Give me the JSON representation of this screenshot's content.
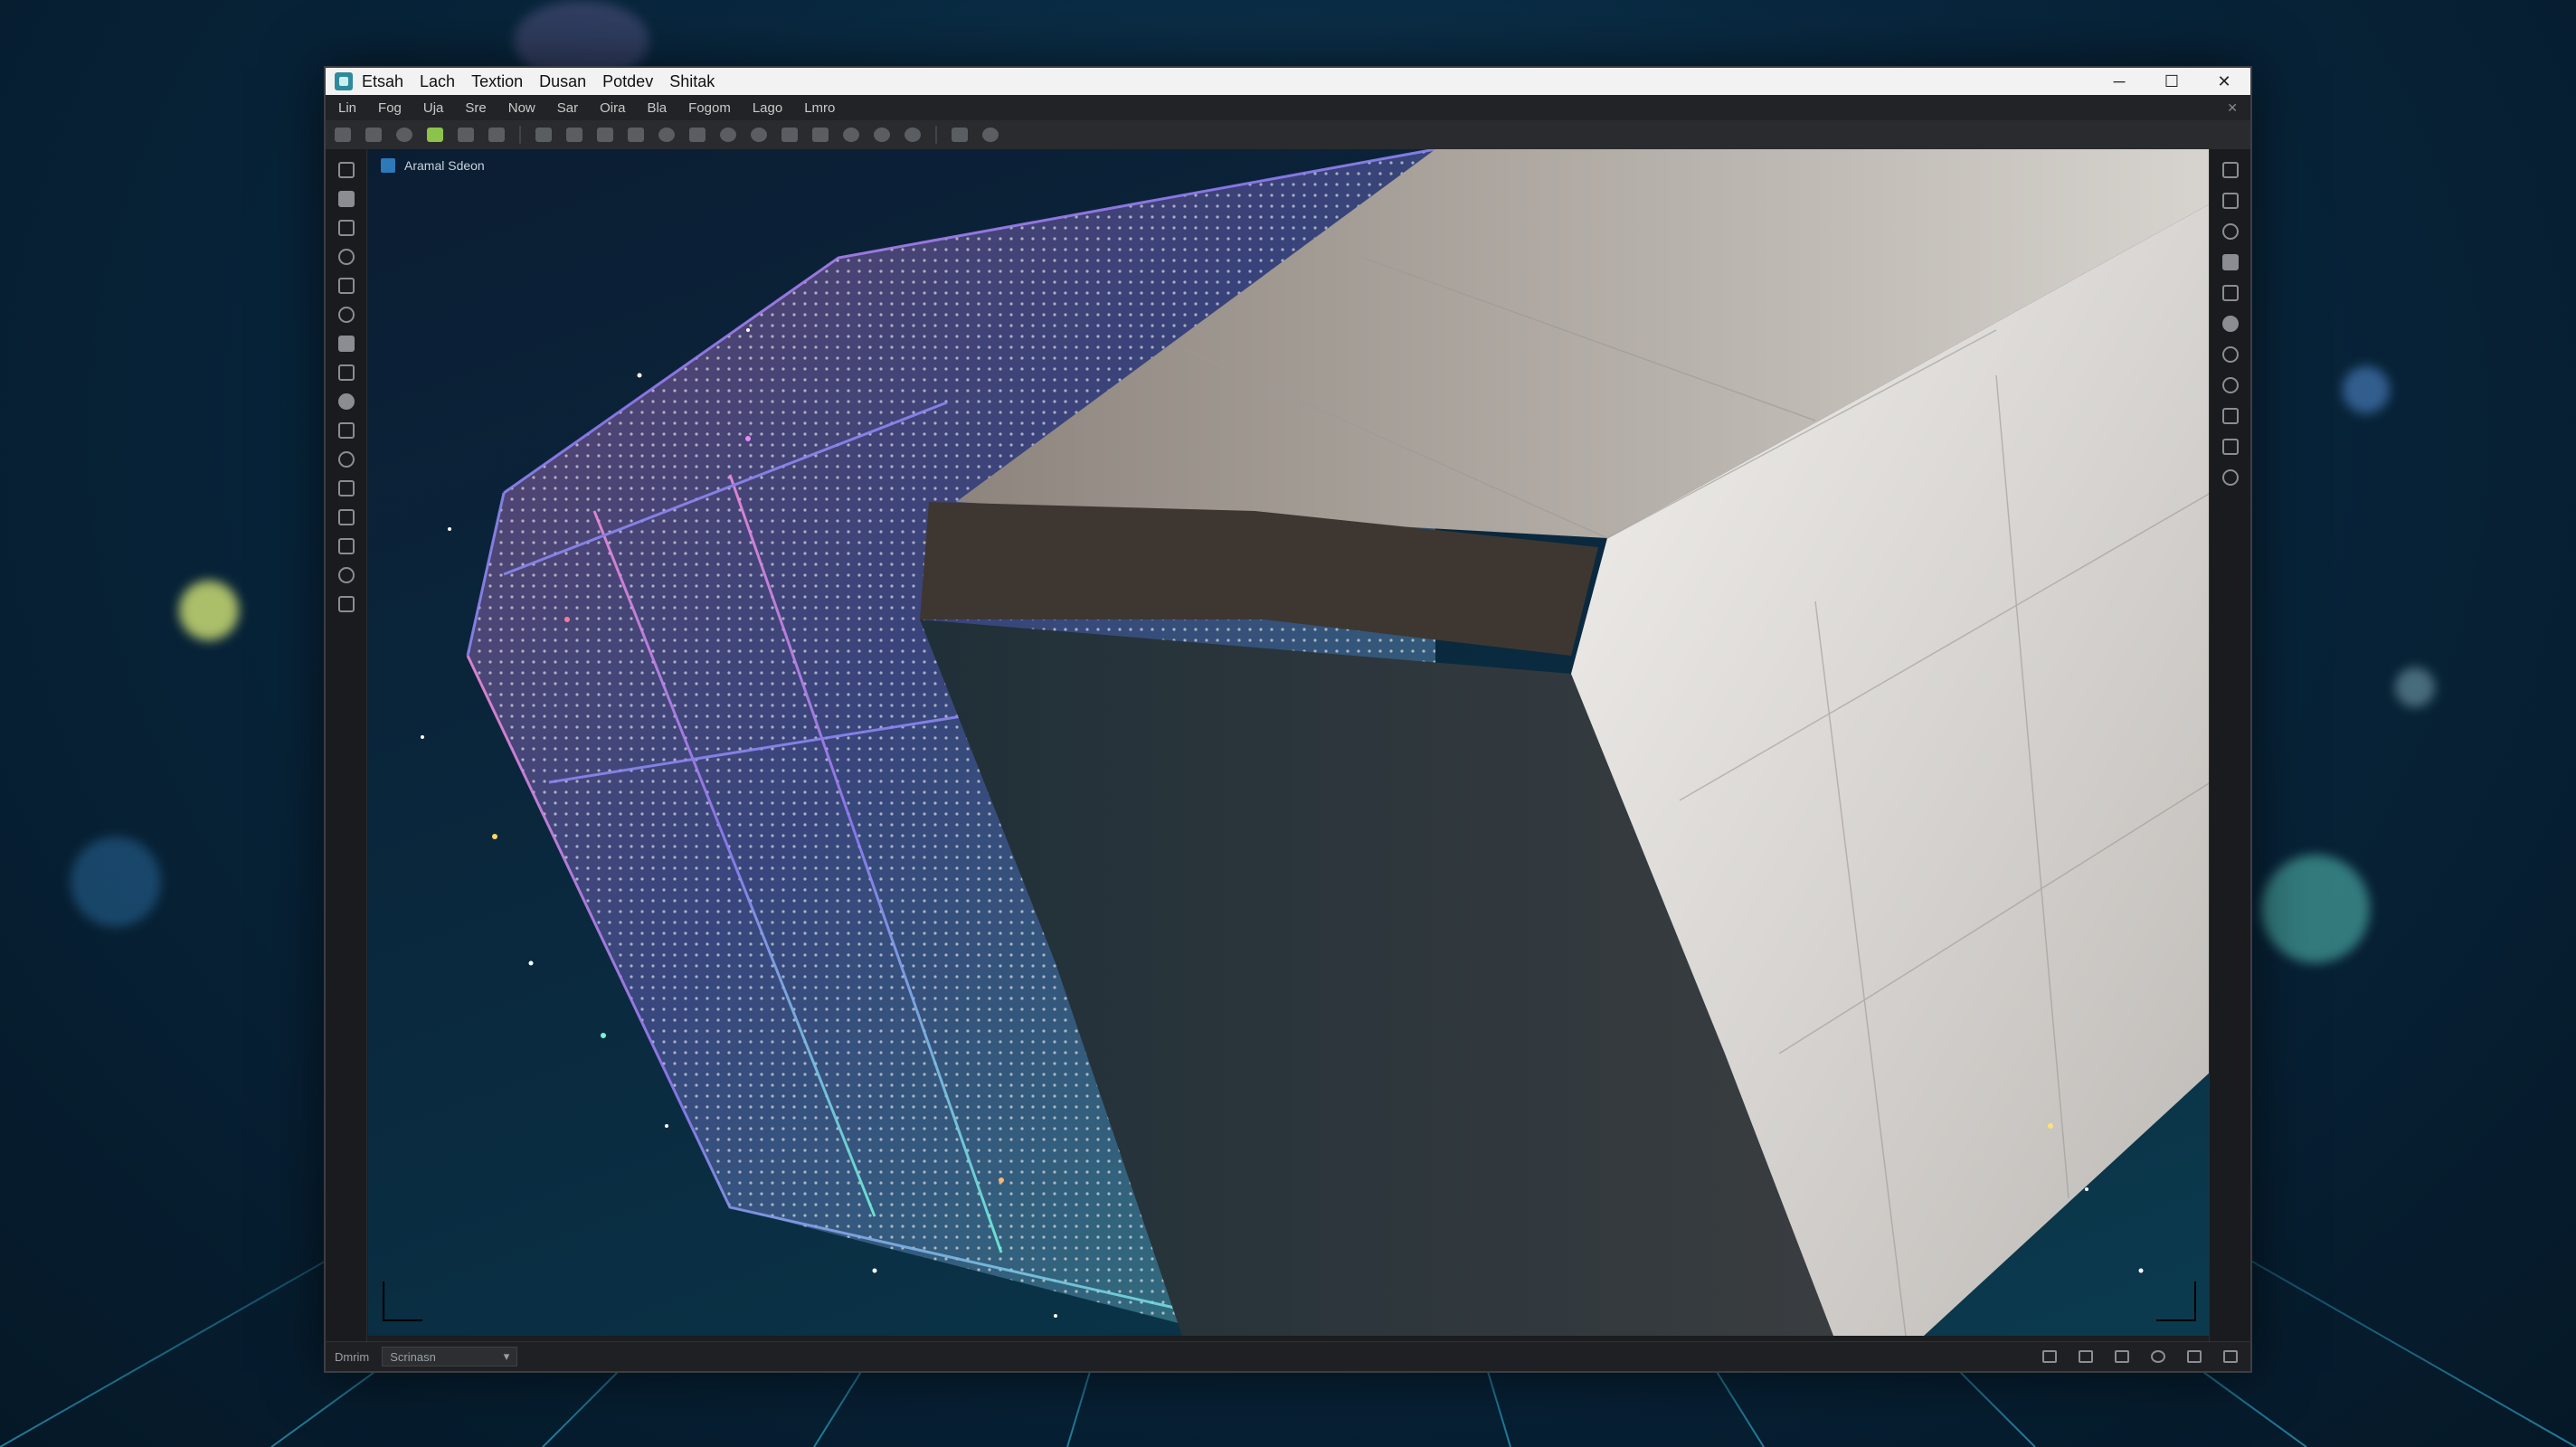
{
  "window": {
    "title_menu": [
      "Etsah",
      "Lach",
      "Textion",
      "Dusan",
      "Potdev",
      "Shitak"
    ],
    "controls": {
      "minimize": "─",
      "maximize": "☐",
      "close": "✕"
    }
  },
  "menubar": {
    "items": [
      "Lin",
      "Fog",
      "Uja",
      "Sre",
      "Now",
      "Sar",
      "Oira",
      "Bla",
      "Fogom",
      "Lago",
      "Lmro"
    ],
    "close_glyph": "✕"
  },
  "viewport": {
    "label": "Aramal Sdeon"
  },
  "statusbar": {
    "mode": "Dmrim",
    "dropdown_value": "Scrinasn",
    "dropdown_arrow": "▾"
  },
  "colors": {
    "accent_green": "#8cc34a",
    "selection_blue": "#2d79b9",
    "corner_guide": "#d7d27a",
    "mesh_light": "#e9e6e2",
    "mesh_dark": "#2d3134"
  },
  "icons": {
    "app": "app-icon",
    "left_tools": [
      "move-icon",
      "rotate-icon",
      "scale-icon",
      "transform-icon",
      "box-icon",
      "zoom-icon",
      "paint-icon",
      "pen-icon",
      "sculpt-icon",
      "layer-icon",
      "sphere-icon",
      "export-icon",
      "grid-icon",
      "crop-icon",
      "loop-icon",
      "camera-icon"
    ],
    "right_tools": [
      "cursor-icon",
      "duplicate-icon",
      "circle-icon",
      "chart-icon",
      "save-icon",
      "material-icon",
      "render-icon",
      "refresh-icon",
      "settings-icon",
      "panel-icon",
      "chevron-down-icon"
    ],
    "status": [
      "screen-icon",
      "camera-icon",
      "link-icon",
      "target-icon",
      "window-icon",
      "expand-icon"
    ]
  }
}
